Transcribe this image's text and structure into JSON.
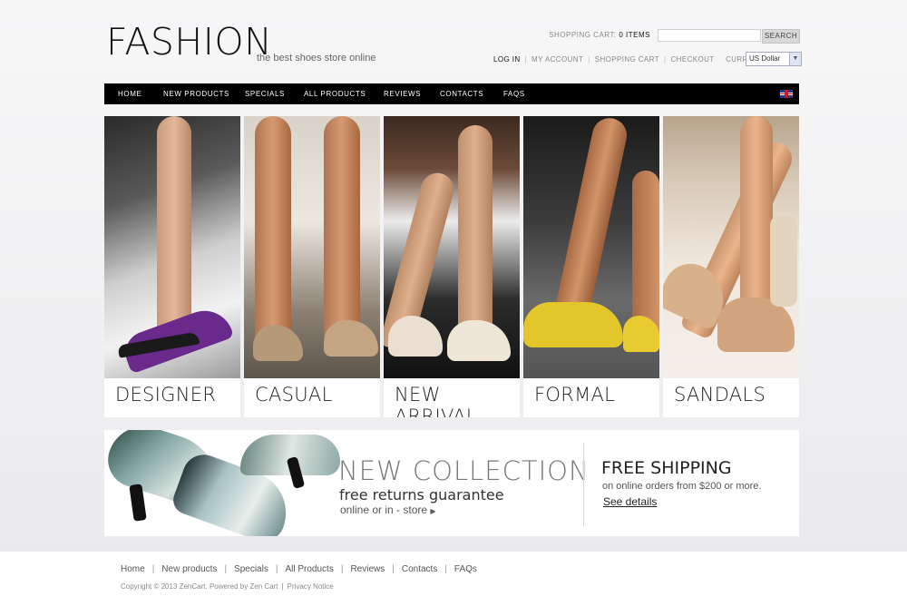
{
  "logo": {
    "text": "FASHION",
    "tagline": "the best shoes store online"
  },
  "header": {
    "cart_label": "SHOPPING CART:",
    "cart_count": "0 ITEMS",
    "search_placeholder": "",
    "search_button": "SEARCH",
    "links": [
      "LOG IN",
      "MY ACCOUNT",
      "SHOPPING CART",
      "CHECKOUT"
    ],
    "currencies_label": "CURRENCIES:",
    "currency_selected": "US Dollar"
  },
  "nav": {
    "items": [
      "HOME",
      "NEW PRODUCTS",
      "SPECIALS",
      "ALL PRODUCTS",
      "REVIEWS",
      "CONTACTS",
      "FAQS"
    ],
    "flag_icon": "uk-flag-icon"
  },
  "categories": [
    {
      "label": "DESIGNER",
      "shoe_color": "#6a2a8c"
    },
    {
      "label": "CASUAL",
      "shoe_color": "#b59a7a"
    },
    {
      "label": "NEW ARRIVAL",
      "shoe_color": "#eadfd0"
    },
    {
      "label": "FORMAL",
      "shoe_color": "#e3c62a"
    },
    {
      "label": "SANDALS",
      "shoe_color": "#d8b08a"
    }
  ],
  "promo": {
    "title": "NEW COLLECTION",
    "subtitle": "free returns guarantee",
    "subtitle2": "online or in - store",
    "shipping_title": "FREE SHIPPING",
    "shipping_sub": "on online orders from $200 or more.",
    "shipping_link": "See details"
  },
  "footer": {
    "links": [
      "Home",
      "New products",
      "Specials",
      "All Products",
      "Reviews",
      "Contacts",
      "FAQs"
    ],
    "copyright": "Copyright © 2013 ZenCart. Powered by Zen Cart",
    "privacy": "Privacy Notice"
  },
  "colors": {
    "nav_bg": "#000000",
    "page_bg": "#f2f2f4",
    "text_dark": "#111111"
  }
}
